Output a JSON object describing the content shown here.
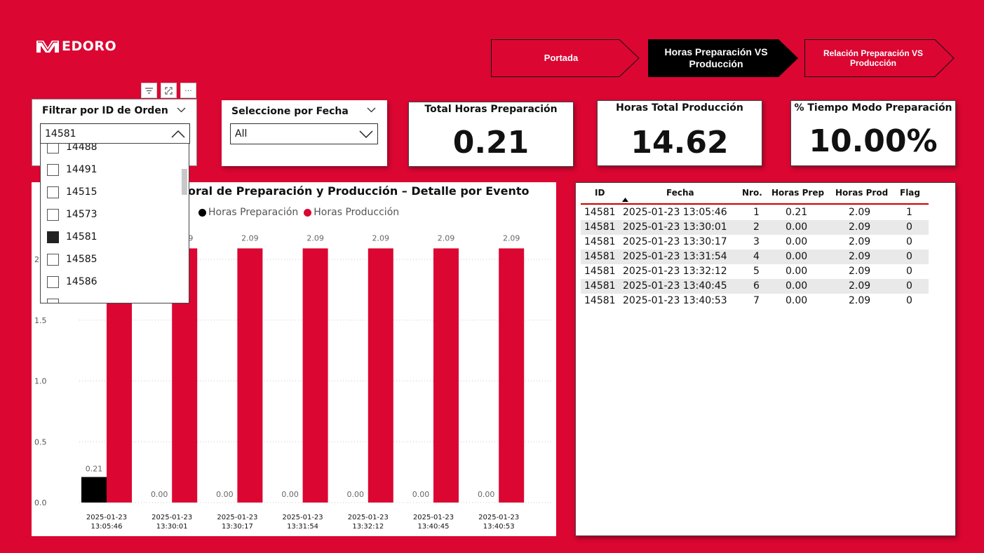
{
  "logo": {
    "text": "EDORO"
  },
  "nav": [
    {
      "label": "Portada",
      "active": false
    },
    {
      "label": "Horas Preparación VS Producción",
      "active": true
    },
    {
      "label": "Relación Preparación VS Producción",
      "active": false
    }
  ],
  "slicer_orden": {
    "title": "Filtrar por ID de Orden",
    "selected": "14581",
    "items": [
      {
        "label": "14488",
        "checked": false
      },
      {
        "label": "14491",
        "checked": false
      },
      {
        "label": "14515",
        "checked": false
      },
      {
        "label": "14573",
        "checked": false
      },
      {
        "label": "14581",
        "checked": true
      },
      {
        "label": "14585",
        "checked": false
      },
      {
        "label": "14586",
        "checked": false
      }
    ]
  },
  "slicer_fecha": {
    "title": "Seleccione por Fecha",
    "selected": "All"
  },
  "kpis": [
    {
      "title": "Total Horas Preparación",
      "value": "0.21"
    },
    {
      "title": "Horas Total Producción",
      "value": "14.62"
    },
    {
      "title": "% Tiempo Modo Preparación",
      "value": "10.00%"
    }
  ],
  "chart_title_visible": "oral de Preparación y Producción – Detalle por Evento",
  "colors": {
    "background": "#db0632",
    "prep": "#000000",
    "prod": "#db0632"
  },
  "chart_data": {
    "type": "bar",
    "title": "oral de Preparación y Producción – Detalle por Evento",
    "categories": [
      "2025-01-23 13:05:46",
      "2025-01-23 13:30:01",
      "2025-01-23 13:30:17",
      "2025-01-23 13:31:54",
      "2025-01-23 13:32:12",
      "2025-01-23 13:40:45",
      "2025-01-23 13:40:53"
    ],
    "category_lines": [
      [
        "2025-01-23",
        "13:05:46"
      ],
      [
        "2025-01-23",
        "13:30:01"
      ],
      [
        "2025-01-23",
        "13:30:17"
      ],
      [
        "2025-01-23",
        "13:31:54"
      ],
      [
        "2025-01-23",
        "13:32:12"
      ],
      [
        "2025-01-23",
        "13:40:45"
      ],
      [
        "2025-01-23",
        "13:40:53"
      ]
    ],
    "series": [
      {
        "name": "Horas Preparación",
        "values": [
          0.21,
          0,
          0,
          0,
          0,
          0,
          0
        ],
        "labels": [
          "0.21",
          "0.00",
          "0.00",
          "0.00",
          "0.00",
          "0.00",
          "0.00"
        ]
      },
      {
        "name": "Horas Producción",
        "values": [
          2.09,
          2.09,
          2.09,
          2.09,
          2.09,
          2.09,
          2.09
        ],
        "labels": [
          "2.09",
          "2.09",
          "2.09",
          "2.09",
          "2.09",
          "2.09",
          "2.09"
        ]
      }
    ],
    "yticks": [
      "0.0",
      "0.5",
      "1.0",
      "1.5",
      "2"
    ],
    "ylim": [
      0,
      2.09
    ],
    "grid": true,
    "legend": "top-left"
  },
  "table": {
    "headers": [
      "ID",
      "Fecha",
      "Nro.",
      "Horas Prep",
      "Horas Prod",
      "Flag"
    ],
    "rows": [
      [
        "14581",
        "2025-01-23 13:05:46",
        "1",
        "0.21",
        "2.09",
        "1"
      ],
      [
        "14581",
        "2025-01-23 13:30:01",
        "2",
        "0.00",
        "2.09",
        "0"
      ],
      [
        "14581",
        "2025-01-23 13:30:17",
        "3",
        "0.00",
        "2.09",
        "0"
      ],
      [
        "14581",
        "2025-01-23 13:31:54",
        "4",
        "0.00",
        "2.09",
        "0"
      ],
      [
        "14581",
        "2025-01-23 13:32:12",
        "5",
        "0.00",
        "2.09",
        "0"
      ],
      [
        "14581",
        "2025-01-23 13:40:45",
        "6",
        "0.00",
        "2.09",
        "0"
      ],
      [
        "14581",
        "2025-01-23 13:40:53",
        "7",
        "0.00",
        "2.09",
        "0"
      ]
    ]
  }
}
